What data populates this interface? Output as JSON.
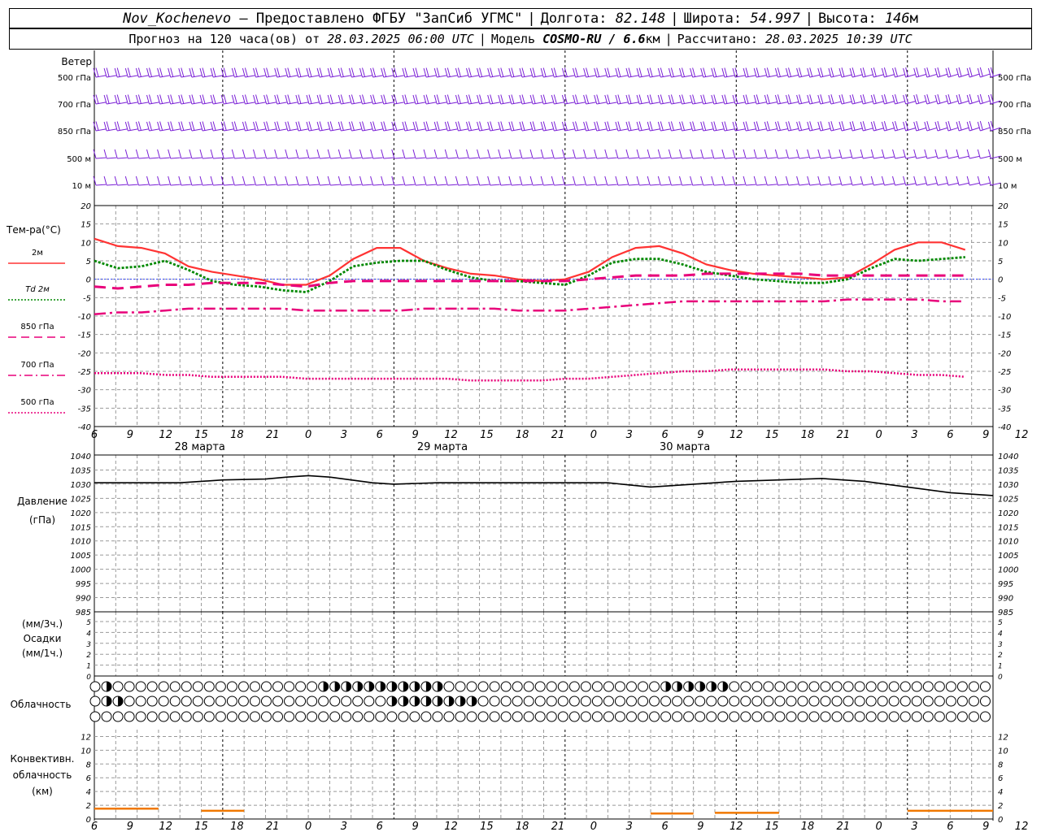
{
  "header": {
    "station": "Nov_Kochenevo",
    "provider": "– Предоставлено ФГБУ \"ЗапСиб УГМС\"",
    "lon_label": "Долгота:",
    "lon": "82.148",
    "lat_label": "Широта:",
    "lat": "54.997",
    "alt_label": "Высота:",
    "alt": "146",
    "alt_unit": "м",
    "forecast_prefix": "Прогноз на 120 часа(ов) от",
    "forecast_start": "28.03.2025 06:00 UTC",
    "model_label": "Модель",
    "model": "COSMO-RU / 6.6",
    "model_unit": "км",
    "calc_label": "Рассчитано:",
    "calc_time": "28.03.2025 10:39 UTC"
  },
  "panels": {
    "wind": {
      "title": "Ветер",
      "levels": [
        "500 гПа",
        "700 гПа",
        "850 гПа",
        "500 м",
        "10  м"
      ]
    },
    "temperature": {
      "title": "Тем-ра(°C)",
      "legend": [
        {
          "label": "2м",
          "color": "#ff3333",
          "dash": "solid"
        },
        {
          "label": "Td  2м",
          "color": "#008800",
          "dash": "dot"
        },
        {
          "label": "850 гПа",
          "color": "#e8007a",
          "dash": "dash"
        },
        {
          "label": "700 гПа",
          "color": "#e8007a",
          "dash": "dashdot"
        },
        {
          "label": "500 гПа",
          "color": "#e8007a",
          "dash": "dot"
        }
      ],
      "yticks": [
        "20",
        "15",
        "10",
        "5",
        "0",
        "-5",
        "-10",
        "-15",
        "-20",
        "-25",
        "-30",
        "-35",
        "-40"
      ],
      "day_labels": [
        "28 марта",
        "29 марта",
        "30 марта"
      ]
    },
    "pressure": {
      "title": "Давление",
      "unit": "(гПа)",
      "yticks": [
        "1040",
        "1035",
        "1030",
        "1025",
        "1020",
        "1015",
        "1010",
        "1005",
        "1000",
        "995",
        "990",
        "985"
      ]
    },
    "precip": {
      "unit_top": "(мм/3ч.)",
      "title": "Осадки",
      "unit_bottom": "(мм/1ч.)",
      "yticks": [
        "5",
        "4",
        "3",
        "2",
        "1",
        "0"
      ]
    },
    "clouds": {
      "title": "Облачность"
    },
    "convective": {
      "title_lines": [
        "Конвективн.",
        "облачность",
        "(км)"
      ],
      "yticks": [
        "12",
        "10",
        "8",
        "6",
        "4",
        "2",
        "0"
      ]
    }
  },
  "time_axis": {
    "labels": [
      "6",
      "9",
      "12",
      "15",
      "18",
      "21",
      "0",
      "3",
      "6",
      "9",
      "12",
      "15",
      "18",
      "21",
      "0",
      "3",
      "6",
      "9",
      "12",
      "15",
      "18",
      "21",
      "0",
      "3",
      "6",
      "9",
      "12"
    ]
  },
  "colors": {
    "wind": "#7a1fd6",
    "t2m": "#ff3333",
    "td2m": "#008800",
    "isobaric": "#e8007a",
    "pressure": "#000000",
    "convective": "#f07800",
    "grid": "#999999"
  },
  "chart_data": [
    {
      "type": "line",
      "title": "Тем-ра(°C)",
      "ylim": [
        -40,
        20
      ],
      "x_hours": [
        0,
        3,
        6,
        9,
        12,
        15,
        18,
        21,
        24,
        27,
        30,
        33,
        36,
        39,
        42,
        45,
        48,
        51,
        54,
        57,
        60,
        63,
        66,
        69,
        72,
        75,
        78,
        81,
        84,
        87,
        90,
        93,
        96,
        99,
        102,
        105,
        108,
        111,
        114,
        117,
        120,
        123,
        126
      ],
      "series": [
        {
          "name": "2м",
          "values": [
            11,
            9,
            8.5,
            7,
            3.5,
            2,
            1,
            0,
            -1.5,
            -1.5,
            1,
            5.5,
            8.5,
            8.5,
            5,
            3,
            1.5,
            1,
            0,
            -0.5,
            0,
            2,
            6,
            8.5,
            9,
            7,
            4,
            2.5,
            1.5,
            1,
            0.5,
            0,
            0.5,
            4,
            8,
            10,
            10,
            8
          ]
        },
        {
          "name": "Td  2м",
          "values": [
            5,
            3,
            3.5,
            5,
            2.5,
            -0.5,
            -1.5,
            -2,
            -3,
            -3.5,
            -0.5,
            3.5,
            4.5,
            5,
            5,
            2.5,
            0.5,
            -0.5,
            -0.5,
            -1,
            -1.5,
            1,
            4.5,
            5.5,
            5.5,
            4,
            2,
            1,
            0,
            -0.5,
            -1,
            -1,
            0,
            3,
            5.5,
            5,
            5.5,
            6
          ]
        },
        {
          "name": "850 гПа",
          "values": [
            -2,
            -2.5,
            -2,
            -1.5,
            -1.5,
            -1,
            -1,
            -1,
            -1.5,
            -2,
            -1,
            -0.5,
            -0.5,
            -0.5,
            -0.5,
            -0.5,
            -0.5,
            -0.5,
            -0.5,
            -0.5,
            -0.5,
            0,
            0.5,
            1,
            1,
            1,
            1.5,
            1.5,
            1.5,
            1.5,
            1.5,
            1,
            1,
            1,
            1,
            1,
            1,
            1
          ]
        },
        {
          "name": "700 гПа",
          "values": [
            -9.5,
            -9,
            -9,
            -8.5,
            -8,
            -8,
            -8,
            -8,
            -8,
            -8.5,
            -8.5,
            -8.5,
            -8.5,
            -8.5,
            -8,
            -8,
            -8,
            -8,
            -8.5,
            -8.5,
            -8.5,
            -8,
            -7.5,
            -7,
            -6.5,
            -6,
            -6,
            -6,
            -6,
            -6,
            -6,
            -6,
            -5.5,
            -5.5,
            -5.5,
            -5.5,
            -6,
            -6
          ]
        },
        {
          "name": "500 гПа",
          "values": [
            -25.5,
            -25.5,
            -25.5,
            -26,
            -26,
            -26.5,
            -26.5,
            -26.5,
            -26.5,
            -27,
            -27,
            -27,
            -27,
            -27,
            -27,
            -27,
            -27.5,
            -27.5,
            -27.5,
            -27.5,
            -27,
            -27,
            -26.5,
            -26,
            -25.5,
            -25,
            -25,
            -24.5,
            -24.5,
            -24.5,
            -24.5,
            -24.5,
            -25,
            -25,
            -25.5,
            -26,
            -26,
            -26.5
          ]
        }
      ]
    },
    {
      "type": "line",
      "title": "Давление",
      "ylim": [
        985,
        1040
      ],
      "x_hours": [
        0,
        6,
        12,
        18,
        24,
        27,
        30,
        33,
        36,
        39,
        42,
        48,
        54,
        60,
        66,
        72,
        78,
        84,
        90,
        96,
        102,
        108,
        114,
        120,
        126
      ],
      "series": [
        {
          "name": "Давление",
          "values": [
            1030.5,
            1030.5,
            1030.5,
            1031.5,
            1031.8,
            1032.5,
            1033,
            1032.5,
            1031.5,
            1030.5,
            1030,
            1030.5,
            1030.5,
            1030.5,
            1030.5,
            1030.5,
            1029,
            1030,
            1031,
            1031.5,
            1032,
            1031,
            1029,
            1027,
            1026
          ]
        }
      ]
    },
    {
      "type": "line",
      "title": "Осадки",
      "ylim": [
        0,
        5
      ],
      "series": [
        {
          "name": "Осадки",
          "values": [
            0
          ]
        }
      ]
    },
    {
      "type": "line",
      "title": "Конвективн. облачность",
      "ylim": [
        0,
        13
      ],
      "segments": [
        {
          "x": [
            0,
            9
          ],
          "value": 1.5
        },
        {
          "x": [
            15,
            21
          ],
          "value": 1.2
        },
        {
          "x": [
            78,
            84
          ],
          "value": 0.8
        },
        {
          "x": [
            87,
            96
          ],
          "value": 0.9
        },
        {
          "x": [
            114,
            126
          ],
          "value": 1.2
        }
      ]
    }
  ]
}
